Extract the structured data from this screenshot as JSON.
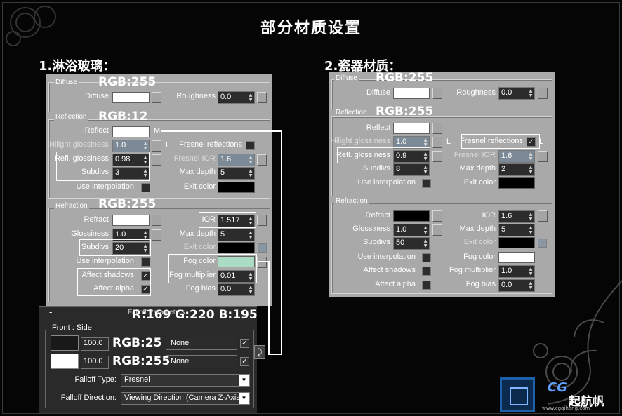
{
  "page_title": "部分材质设置",
  "section1_title": "1.淋浴玻璃：",
  "section2_title": "2.瓷器材质：",
  "labels": {
    "diffuse_group": "Diffuse",
    "diffuse": "Diffuse",
    "roughness": "Roughness",
    "reflection_group": "Reflection",
    "reflect": "Reflect",
    "hilight_glossiness": "Hilight glossiness",
    "refl_glossiness": "Refl. glossiness",
    "subdivs": "Subdivs",
    "use_interpolation": "Use interpolation",
    "fresnel_reflections": "Fresnel reflections",
    "fresnel_ior": "Fresnel IOR",
    "max_depth": "Max depth",
    "exit_color": "Exit color",
    "refraction_group": "Refraction",
    "refract": "Refract",
    "glossiness": "Glossiness",
    "ior": "IOR",
    "affect_shadows": "Affect shadows",
    "affect_alpha": "Affect alpha",
    "fog_color": "Fog color",
    "fog_multiplier": "Fog multiplier",
    "fog_bias": "Fog bias",
    "l_button": "L",
    "m_button": "M"
  },
  "glass": {
    "roughness": "0.0",
    "hilight_glossiness": "1.0",
    "refl_glossiness": "0.98",
    "refl_subdivs": "3",
    "fresnel_ior": "1.6",
    "refl_max_depth": "5",
    "refr_glossiness": "1.0",
    "refr_subdivs": "20",
    "ior": "1.517",
    "refr_max_depth": "5",
    "fog_multiplier": "0.01",
    "fog_bias": "0.0",
    "colors": {
      "diffuse": "#ffffff",
      "reflect": "#ffffff",
      "exit": "#000000",
      "refract": "#ffffff",
      "fog": "#a9dcc3"
    }
  },
  "ceramic": {
    "roughness": "0.0",
    "hilight_glossiness": "1.0",
    "refl_glossiness": "0.9",
    "refl_subdivs": "8",
    "fresnel_ior": "1.6",
    "refl_max_depth": "2",
    "refr_glossiness": "1.0",
    "refr_subdivs": "50",
    "ior": "1.6",
    "refr_max_depth": "5",
    "fog_multiplier": "1.0",
    "fog_bias": "0.0",
    "colors": {
      "diffuse": "#ffffff",
      "reflect": "#ffffff",
      "exit": "#000000",
      "refract": "#000000",
      "fog": "#ffffff"
    }
  },
  "annotations": {
    "glass_diffuse": "RGB:255",
    "glass_reflect": "RGB:12",
    "glass_refract": "RGB:255",
    "glass_fog": "R:169 G:220 B:195",
    "falloff_color1": "RGB:25",
    "falloff_color2": "RGB:255",
    "ceramic_diffuse": "RGB:255",
    "ceramic_reflect": "RGB:255"
  },
  "falloff": {
    "rollout_minus": "-",
    "rollout_title": "Falloff Parameters",
    "front_side": "Front : Side",
    "value1": "100.0",
    "value2": "100.0",
    "map1": "None",
    "map2": "None",
    "type_label": "Falloff Type:",
    "type_value": "Fresnel",
    "direction_label": "Falloff Direction:",
    "direction_value": "Viewing Direction (Camera Z-Axis)",
    "swap_icon": "swap-icon",
    "colors": {
      "color1": "#191919",
      "color2": "#ffffff"
    }
  },
  "logo": {
    "text": "起航帆",
    "cg": "CG",
    "site": "www.cgqihang.com"
  },
  "icons": {
    "spinner": "spinner-arrows-icon",
    "check": "check-icon",
    "dropdown": "dropdown-arrow-icon",
    "swap": "swap-icon"
  }
}
